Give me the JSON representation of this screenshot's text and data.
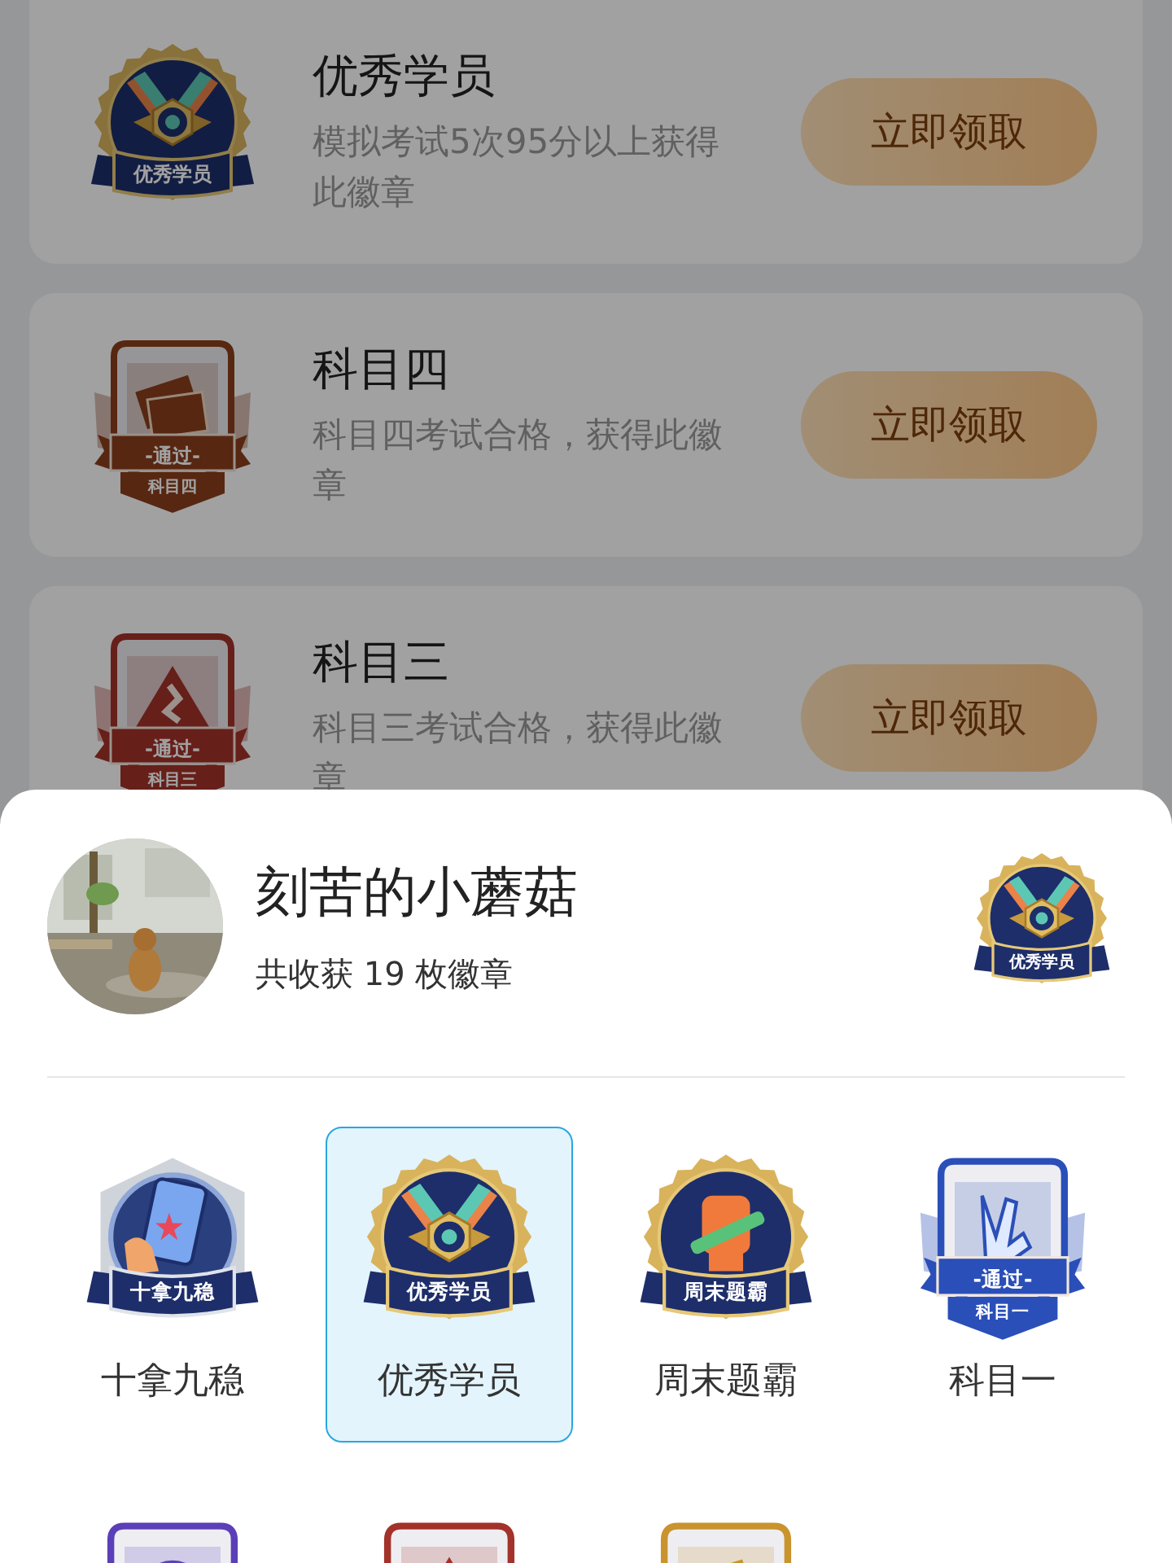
{
  "achievements": [
    {
      "title": "优秀学员",
      "description": "模拟考试5次95分以上获得此徽章",
      "button": "立即领取",
      "badge": {
        "kind": "medal-s",
        "ribbon": "优秀学员"
      }
    },
    {
      "title": "科目四",
      "description": "科目四考试合格，获得此徽章",
      "button": "立即领取",
      "badge": {
        "kind": "shield-cards",
        "ribbon": "-通过-",
        "sublabel": "科目四"
      }
    },
    {
      "title": "科目三",
      "description": "科目三考试合格，获得此徽章",
      "button": "立即领取",
      "badge": {
        "kind": "shield-sign",
        "ribbon": "-通过-",
        "sublabel": "科目三"
      }
    }
  ],
  "sheet": {
    "user": {
      "name": "刻苦的小蘑菇",
      "summary": "共收获 19 枚徽章",
      "featured_badge": {
        "kind": "medal-s",
        "ribbon": "优秀学员"
      }
    },
    "badges": [
      {
        "label": "十拿九稳",
        "selected": false,
        "badge": {
          "kind": "hex-phone",
          "ribbon": "十拿九稳"
        }
      },
      {
        "label": "优秀学员",
        "selected": true,
        "badge": {
          "kind": "medal-s",
          "ribbon": "优秀学员"
        }
      },
      {
        "label": "周末题霸",
        "selected": false,
        "badge": {
          "kind": "medal-fist",
          "ribbon": "周末题霸"
        }
      },
      {
        "label": "科目一",
        "selected": false,
        "badge": {
          "kind": "shield-hand",
          "color": "#2a4fb8",
          "ribbon": "-通过-",
          "sublabel": "科目一"
        }
      },
      {
        "selected": false,
        "badge": {
          "kind": "shield-disc",
          "color": "#5b3fb8"
        }
      },
      {
        "selected": false,
        "badge": {
          "kind": "shield-sign",
          "color": "#a3322a"
        }
      },
      {
        "selected": false,
        "badge": {
          "kind": "shield-cards",
          "color": "#c9932e"
        }
      }
    ]
  }
}
